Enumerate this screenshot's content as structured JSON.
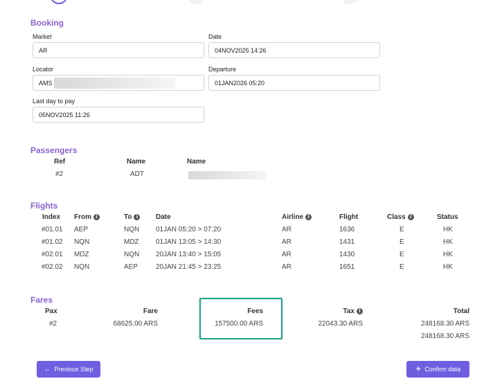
{
  "booking": {
    "title": "Booking",
    "market_label": "Market",
    "market_value": "AR",
    "date_label": "Date",
    "date_value": "04NOV2025 14:26",
    "locator_label": "Locator",
    "locator_value": "AMS",
    "departure_label": "Departure",
    "departure_value": "01JAN2026 05:20",
    "last_day_label": "Last day to pay",
    "last_day_value": "05NOV2025 11:26"
  },
  "passengers": {
    "title": "Passengers",
    "headers": {
      "ref": "Ref",
      "name1": "Name",
      "name2": "Name"
    },
    "rows": [
      {
        "ref": "#2",
        "type": "ADT"
      }
    ]
  },
  "flights": {
    "title": "Flights",
    "headers": {
      "index": "Index",
      "from": "From",
      "to": "To",
      "date": "Date",
      "airline": "Airline",
      "flight": "Flight",
      "class": "Class",
      "status": "Status"
    },
    "rows": [
      {
        "index": "#01.01",
        "from": "AEP",
        "to": "NQN",
        "date": "01JAN 05:20 > 07:20",
        "airline": "AR",
        "flight": "1636",
        "class": "E",
        "status": "HK"
      },
      {
        "index": "#01.02",
        "from": "NQN",
        "to": "MDZ",
        "date": "01JAN 13:05 > 14:30",
        "airline": "AR",
        "flight": "1431",
        "class": "E",
        "status": "HK"
      },
      {
        "index": "#02.01",
        "from": "MDZ",
        "to": "NQN",
        "date": "20JAN 13:40 > 15:05",
        "airline": "AR",
        "flight": "1430",
        "class": "E",
        "status": "HK"
      },
      {
        "index": "#02.02",
        "from": "NQN",
        "to": "AEP",
        "date": "20JAN 21:45 > 23:25",
        "airline": "AR",
        "flight": "1651",
        "class": "E",
        "status": "HK"
      }
    ]
  },
  "fares": {
    "title": "Fares",
    "headers": {
      "pax": "Pax",
      "fare": "Fare",
      "fees": "Fees",
      "tax": "Tax",
      "total": "Total"
    },
    "row": {
      "pax": "#2",
      "fare": "68625.00 ARS",
      "fees": "157500.00 ARS",
      "tax": "22043.30 ARS",
      "total": "248168.30 ARS"
    },
    "grand_total": "248168.30 ARS"
  },
  "actions": {
    "previous_label": "Previous Step",
    "confirm_label": "Confirm data"
  },
  "icons": {
    "info": "info-icon",
    "back": "arrow-left-icon",
    "confirm": "plane-confirm-icon"
  },
  "colors": {
    "accent": "#6f5ee0",
    "section_title": "#8a63d2",
    "highlight": "#1aa68a"
  }
}
